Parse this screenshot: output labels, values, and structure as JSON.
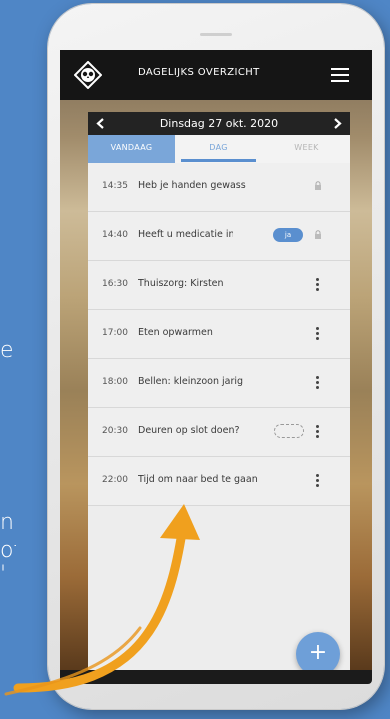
{
  "background_fragments": {
    "frag1": "e",
    "frag2": "n",
    "frag3": "of",
    "frag4": "'"
  },
  "app": {
    "title": "DAGELIJKS OVERZICHT",
    "logo_icon": "owl-logo-icon",
    "menu_icon": "hamburger-menu-icon"
  },
  "date_nav": {
    "date": "Dinsdag 27 okt. 2020",
    "prev_icon": "chevron-left-icon",
    "next_icon": "chevron-right-icon"
  },
  "tabs": [
    {
      "label": "VANDAAG",
      "state": "active-filled"
    },
    {
      "label": "DAG",
      "state": "selected-underline"
    },
    {
      "label": "WEEK",
      "state": "inactive"
    }
  ],
  "schedule": [
    {
      "time": "14:35",
      "title": "Heb je handen gewass",
      "action": "lock-icon"
    },
    {
      "time": "14:40",
      "title": "Heeft u medicatie inge",
      "badge": "ja",
      "action": "lock-icon"
    },
    {
      "time": "16:30",
      "title": "Thuiszorg: Kirsten",
      "action": "more-vertical-icon"
    },
    {
      "time": "17:00",
      "title": "Eten opwarmen",
      "action": "more-vertical-icon"
    },
    {
      "time": "18:00",
      "title": "Bellen: kleinzoon jarig",
      "action": "more-vertical-icon"
    },
    {
      "time": "20:30",
      "title": "Deuren op slot doen?",
      "action": "more-vertical-icon"
    },
    {
      "time": "22:00",
      "title": "Tijd om naar bed te gaan",
      "action": "more-vertical-icon"
    }
  ],
  "fab": {
    "label": "+"
  },
  "colors": {
    "page_background": "#4f86c6",
    "accent_blue": "#7aa6d9",
    "topbar": "#151515",
    "annotation_arrow": "#f0a01e"
  }
}
